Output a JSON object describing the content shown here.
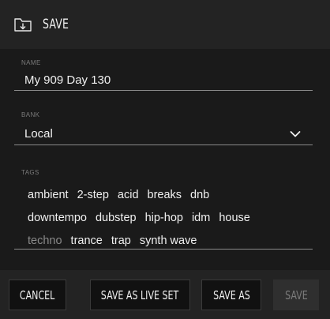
{
  "header": {
    "title": "SAVE",
    "icon": "folder-download-icon"
  },
  "name_field": {
    "label": "NAME",
    "value": "My 909 Day 130"
  },
  "bank_field": {
    "label": "BANK",
    "value": "Local",
    "icon": "chevron-down-icon"
  },
  "tags_field": {
    "label": "TAGS",
    "rows": [
      [
        "ambient",
        "2-step",
        "acid",
        "breaks",
        "dnb"
      ],
      [
        "downtempo",
        "dubstep",
        "hip-hop",
        "idm",
        "house"
      ],
      [
        "techno",
        "trance",
        "trap",
        "synth wave"
      ]
    ],
    "dimmed": [
      "techno"
    ]
  },
  "buttons": {
    "cancel": "CANCEL",
    "save_live_set": "SAVE AS LIVE SET",
    "save_as": "SAVE AS",
    "save": "SAVE"
  },
  "colors": {
    "background": "#232323",
    "form_background": "#1a1a1a",
    "button_background": "#111111",
    "disabled_button": "#2f2f2f",
    "text": "#f0f0f0",
    "muted_text": "#7a7a7a"
  }
}
